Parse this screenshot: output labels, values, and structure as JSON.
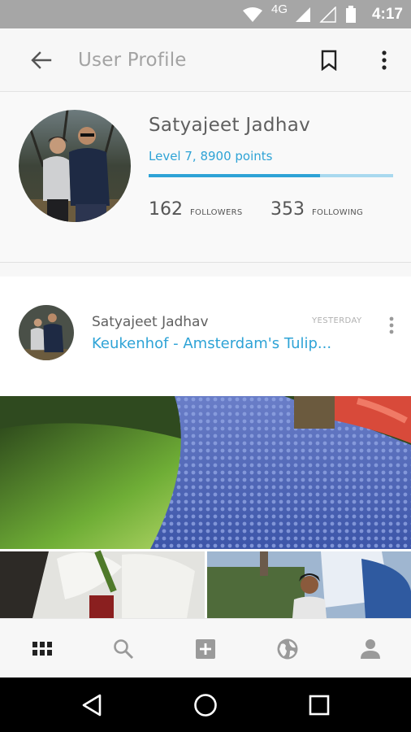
{
  "status_bar": {
    "network": "4G",
    "time": "4:17",
    "icons": [
      "wifi-icon",
      "signal-icon",
      "signal-empty-icon",
      "battery-icon"
    ]
  },
  "app_bar": {
    "title": "User Profile",
    "icons": [
      "back-arrow-icon",
      "bookmark-icon",
      "more-vert-icon"
    ]
  },
  "profile": {
    "name": "Satyajeet Jadhav",
    "level_text": "Level 7, 8900 points",
    "level_progress": 0.7,
    "followers": {
      "count": "162",
      "label": "FOLLOWERS"
    },
    "following": {
      "count": "353",
      "label": "FOLLOWING"
    }
  },
  "post": {
    "author": "Satyajeet Jadhav",
    "time": "YESTERDAY",
    "title": "Keukenhof - Amsterdam's Tulip..."
  },
  "bottom_nav": {
    "items": [
      "grid-icon",
      "search-icon",
      "add-box-icon",
      "globe-icon",
      "person-icon"
    ]
  },
  "system_nav": {
    "items": [
      "back-triangle-icon",
      "home-circle-icon",
      "recents-square-icon"
    ]
  },
  "colors": {
    "accent": "#2ea3d6",
    "status_bar": "#a6a6a6",
    "text": "#5f5f5f"
  }
}
